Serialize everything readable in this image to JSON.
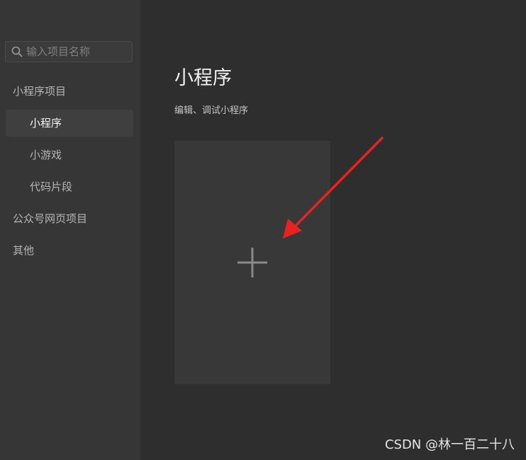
{
  "search": {
    "placeholder": "输入项目名称",
    "value": ""
  },
  "sidebar": {
    "groups": [
      {
        "label": "小程序项目",
        "items": [
          {
            "label": "小程序",
            "active": true
          },
          {
            "label": "小游戏",
            "active": false
          },
          {
            "label": "代码片段",
            "active": false
          }
        ]
      },
      {
        "label": "公众号网页项目",
        "items": []
      },
      {
        "label": "其他",
        "items": []
      }
    ]
  },
  "main": {
    "title": "小程序",
    "subtitle": "编辑、调试小程序",
    "new_card_icon": "plus-icon"
  },
  "annotation": {
    "arrow_color": "#e8231f"
  },
  "watermark": "CSDN @林一百二十八",
  "colors": {
    "sidebar_bg": "#363636",
    "main_bg": "#2e2e2e",
    "card_bg": "#383838",
    "active_item_bg": "#3f3f3f"
  }
}
